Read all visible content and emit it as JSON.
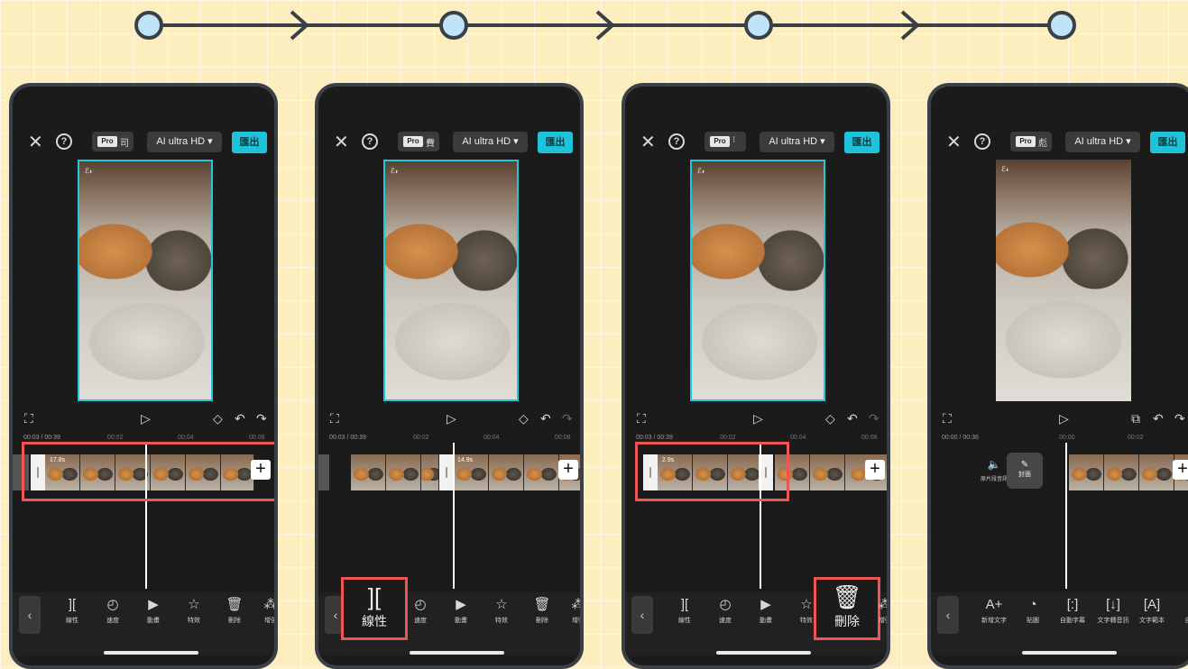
{
  "colors": {
    "accent": "#1fc3d9",
    "highlight": "#ee5555",
    "node": "#bfe3f7",
    "background": "#fdeec0"
  },
  "flow": {
    "node_count": 4,
    "arrow_count": 3
  },
  "top_bar": {
    "close_icon": "close-icon",
    "help_icon": "help-icon",
    "pro_tag": "Pro",
    "hd_label": "AI ultra HD ▾",
    "export_label": "匯出"
  },
  "preview": {
    "watermark": "ℰ𝓇"
  },
  "controls": {
    "fullscreen_icon": "⛶",
    "play_icon": "▷",
    "keyframe_icon": "◇",
    "undo_icon": "↶",
    "redo_icon": "↷",
    "caption_icon": "⧉"
  },
  "phones": [
    {
      "pro_char": "司",
      "timecode": "00:03 / 00:39",
      "ruler": [
        "00:02",
        "00:04",
        "00:06"
      ],
      "clip_duration": "17.8s",
      "tools": [
        {
          "icon": "][",
          "label": "線性"
        },
        {
          "icon": "◴",
          "label": "速度"
        },
        {
          "icon": "▶",
          "label": "動畫"
        },
        {
          "icon": "☆",
          "label": "特效"
        },
        {
          "icon": "🗑",
          "label": "刪除"
        },
        {
          "icon": "⁂",
          "label": "增強"
        }
      ]
    },
    {
      "pro_char": "費",
      "timecode": "00:03 / 00:39",
      "ruler": [
        "00:02",
        "00:04",
        "00:06"
      ],
      "clip_duration": "14.9s",
      "big_button": {
        "icon": "][",
        "label": "線性"
      },
      "tools": [
        {
          "icon": "◴",
          "label": "速度"
        },
        {
          "icon": "▶",
          "label": "動畫"
        },
        {
          "icon": "☆",
          "label": "特效"
        },
        {
          "icon": "🗑",
          "label": "刪除"
        },
        {
          "icon": "⁂",
          "label": "增強"
        }
      ]
    },
    {
      "pro_char": "⁝",
      "timecode": "00:03 / 00:39",
      "ruler": [
        "00:02",
        "00:04",
        "00:06"
      ],
      "clip_duration": "2.9s",
      "big_button": {
        "icon": "🗑",
        "label": "刪除"
      },
      "tools": [
        {
          "icon": "][",
          "label": "線性"
        },
        {
          "icon": "◴",
          "label": "速度"
        },
        {
          "icon": "▶",
          "label": "動畫"
        },
        {
          "icon": "☆",
          "label": "特效"
        },
        {
          "icon": "⁂",
          "label": "增強"
        }
      ]
    },
    {
      "pro_char": "彪",
      "timecode": "00:00 / 00:36",
      "ruler": [
        "00:00",
        "00:02"
      ],
      "audio_label": "原片段音訊",
      "cover_label": "封面",
      "tools": [
        {
          "icon": "A+",
          "label": "新增文字"
        },
        {
          "icon": "◔",
          "label": "貼圖"
        },
        {
          "icon": "[:]",
          "label": "自動字幕"
        },
        {
          "icon": "[↓]",
          "label": "文字轉音訊"
        },
        {
          "icon": "[A]",
          "label": "文字範本"
        },
        {
          "icon": "",
          "label": "自"
        }
      ]
    }
  ]
}
